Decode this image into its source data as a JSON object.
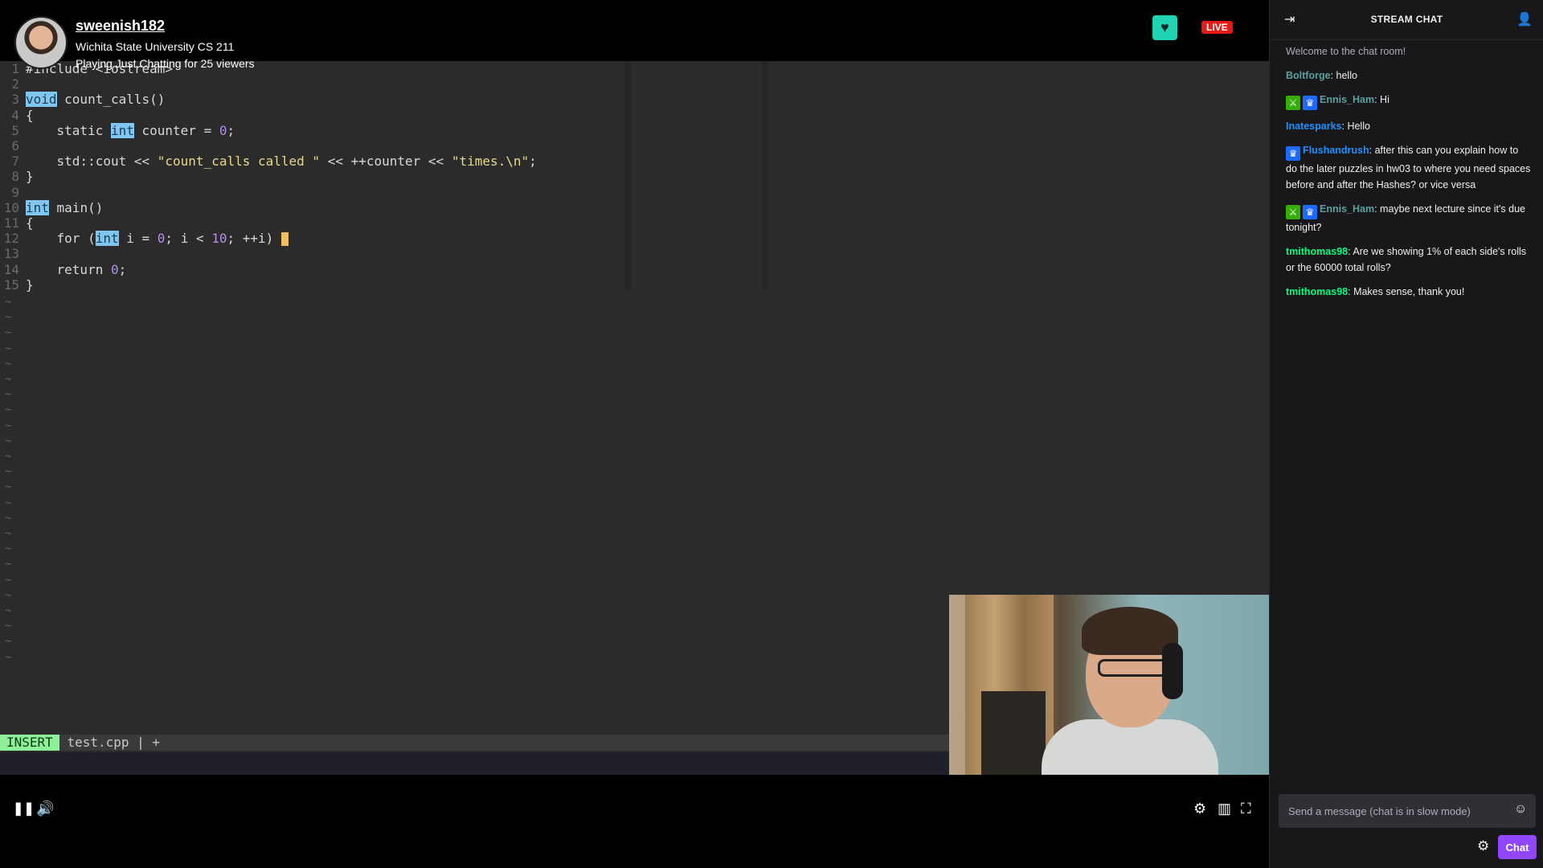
{
  "channel": {
    "username": "sweenish182",
    "title": "Wichita State University CS 211",
    "playing": "Playing Just Chatting for 25 viewers",
    "live_label": "LIVE"
  },
  "editor": {
    "mode": "INSERT",
    "filename": "test.cpp",
    "status_sep": " | ",
    "status_plus": "+",
    "lines": [
      {
        "n": "1",
        "parts": [
          {
            "t": "#include <iostream>",
            "c": "kw"
          }
        ]
      },
      {
        "n": "2",
        "parts": []
      },
      {
        "n": "3",
        "parts": [
          {
            "t": "void",
            "c": "kw-hl"
          },
          {
            "t": " count_calls()",
            "c": "kw"
          }
        ]
      },
      {
        "n": "4",
        "parts": [
          {
            "t": "{",
            "c": "kw"
          }
        ]
      },
      {
        "n": "5",
        "parts": [
          {
            "t": "    static ",
            "c": "kw"
          },
          {
            "t": "int",
            "c": "kw-hl"
          },
          {
            "t": " counter = ",
            "c": "kw"
          },
          {
            "t": "0",
            "c": "num"
          },
          {
            "t": ";",
            "c": "kw"
          }
        ]
      },
      {
        "n": "6",
        "parts": []
      },
      {
        "n": "7",
        "parts": [
          {
            "t": "    std::cout << ",
            "c": "kw"
          },
          {
            "t": "\"count_calls called \"",
            "c": "str"
          },
          {
            "t": " << ++counter << ",
            "c": "kw"
          },
          {
            "t": "\"times.\\n\"",
            "c": "str"
          },
          {
            "t": ";",
            "c": "kw"
          }
        ]
      },
      {
        "n": "8",
        "parts": [
          {
            "t": "}",
            "c": "kw"
          }
        ]
      },
      {
        "n": "9",
        "parts": []
      },
      {
        "n": "10",
        "parts": [
          {
            "t": "int",
            "c": "kw-hl"
          },
          {
            "t": " main()",
            "c": "kw"
          }
        ]
      },
      {
        "n": "11",
        "parts": [
          {
            "t": "{",
            "c": "kw"
          }
        ]
      },
      {
        "n": "12",
        "parts": [
          {
            "t": "    for (",
            "c": "kw"
          },
          {
            "t": "int",
            "c": "kw-hl"
          },
          {
            "t": " i = ",
            "c": "kw"
          },
          {
            "t": "0",
            "c": "num"
          },
          {
            "t": "; i < ",
            "c": "kw"
          },
          {
            "t": "10",
            "c": "num"
          },
          {
            "t": "; ++i) ",
            "c": "kw"
          },
          {
            "t": "",
            "c": "cursor"
          }
        ]
      },
      {
        "n": "13",
        "parts": []
      },
      {
        "n": "14",
        "parts": [
          {
            "t": "    return ",
            "c": "kw"
          },
          {
            "t": "0",
            "c": "num"
          },
          {
            "t": ";",
            "c": "kw"
          }
        ]
      },
      {
        "n": "15",
        "parts": [
          {
            "t": "}",
            "c": "kw"
          }
        ]
      }
    ],
    "empty_marker": "~",
    "empty_line_count": 24
  },
  "player_controls": {
    "pause_icon": "pause-icon",
    "volume_icon": "volume-icon",
    "settings_icon": "gear-icon",
    "theatre_icon": "theatre-mode-icon",
    "fullscreen_icon": "fullscreen-icon"
  },
  "chat": {
    "header": "STREAM CHAT",
    "welcome": "Welcome to the chat room!",
    "messages": [
      {
        "user": "Boltforge",
        "color": "#5f9ea0",
        "badges": [],
        "text": "hello"
      },
      {
        "user": "Ennis_Ham",
        "color": "#5f9ea0",
        "badges": [
          "moderator",
          "subscriber"
        ],
        "text": "Hi"
      },
      {
        "user": "Inatesparks",
        "color": "#1e90ff",
        "badges": [],
        "text": "Hello"
      },
      {
        "user": "Flushandrush",
        "color": "#1e90ff",
        "badges": [
          "subscriber"
        ],
        "text": "after this can you explain how to do the later puzzles in hw03 to where you need spaces before and after the Hashes? or vice versa"
      },
      {
        "user": "Ennis_Ham",
        "color": "#5f9ea0",
        "badges": [
          "moderator",
          "subscriber"
        ],
        "text": "maybe next lecture since it's due tonight?"
      },
      {
        "user": "tmithomas98",
        "color": "#00ff7f",
        "badges": [],
        "text": "Are we showing 1% of each side's rolls or the 60000 total rolls?"
      },
      {
        "user": "tmithomas98",
        "color": "#00ff7f",
        "badges": [],
        "text": "Makes sense, thank you!"
      }
    ],
    "input_placeholder": "Send a message (chat is in slow mode)",
    "send_label": "Chat"
  },
  "colors": {
    "live": "#e91916",
    "heart_button": "#1fd3b3",
    "chat_button": "#9147ff",
    "insert_mode": "#8ff09a"
  }
}
